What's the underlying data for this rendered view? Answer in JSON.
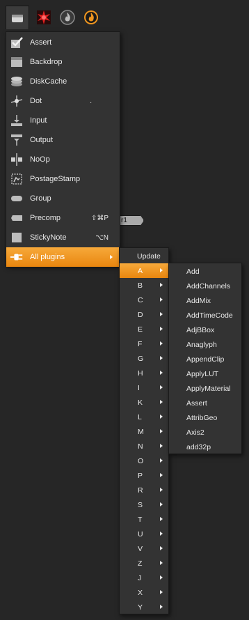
{
  "toolbar": {
    "buttons": [
      {
        "icon": "toolsets-icon",
        "active": true
      },
      {
        "icon": "red-star-icon",
        "active": false
      },
      {
        "icon": "fire-grey-icon",
        "active": false
      },
      {
        "icon": "fire-orange-icon",
        "active": false
      }
    ]
  },
  "node_fragment": {
    "label": "r1"
  },
  "main_menu": {
    "items": [
      {
        "label": "Assert",
        "icon": "checkmark-icon",
        "shortcut": ""
      },
      {
        "label": "Backdrop",
        "icon": "backdrop-icon",
        "shortcut": ""
      },
      {
        "label": "DiskCache",
        "icon": "disk-stack-icon",
        "shortcut": ""
      },
      {
        "label": "Dot",
        "icon": "dot-icon",
        "shortcut": "."
      },
      {
        "label": "Input",
        "icon": "input-arrow-icon",
        "shortcut": ""
      },
      {
        "label": "Output",
        "icon": "output-arrow-icon",
        "shortcut": ""
      },
      {
        "label": "NoOp",
        "icon": "noop-icon",
        "shortcut": ""
      },
      {
        "label": "PostageStamp",
        "icon": "postage-stamp-icon",
        "shortcut": ""
      },
      {
        "label": "Group",
        "icon": "group-icon",
        "shortcut": ""
      },
      {
        "label": "Precomp",
        "icon": "precomp-icon",
        "shortcut": "⇧⌘P"
      },
      {
        "label": "StickyNote",
        "icon": "sticky-note-icon",
        "shortcut": "⌥N"
      },
      {
        "label": "All plugins",
        "icon": "plug-icon",
        "shortcut": "",
        "highlighted": true
      }
    ]
  },
  "letters_menu": {
    "update_label": "Update",
    "letters": [
      "A",
      "B",
      "C",
      "D",
      "E",
      "F",
      "G",
      "H",
      "I",
      "K",
      "L",
      "M",
      "N",
      "O",
      "P",
      "R",
      "S",
      "T",
      "U",
      "V",
      "Z",
      "J",
      "X",
      "Y"
    ],
    "highlighted": "A"
  },
  "plugins_menu": {
    "items": [
      "Add",
      "AddChannels",
      "AddMix",
      "AddTimeCode",
      "AdjBBox",
      "Anaglyph",
      "AppendClip",
      "ApplyLUT",
      "ApplyMaterial",
      "Assert",
      "AttribGeo",
      "Axis2",
      "add32p"
    ]
  },
  "colors": {
    "highlight": "#f0961f",
    "menu_bg": "#333333",
    "canvas_bg": "#262626"
  }
}
